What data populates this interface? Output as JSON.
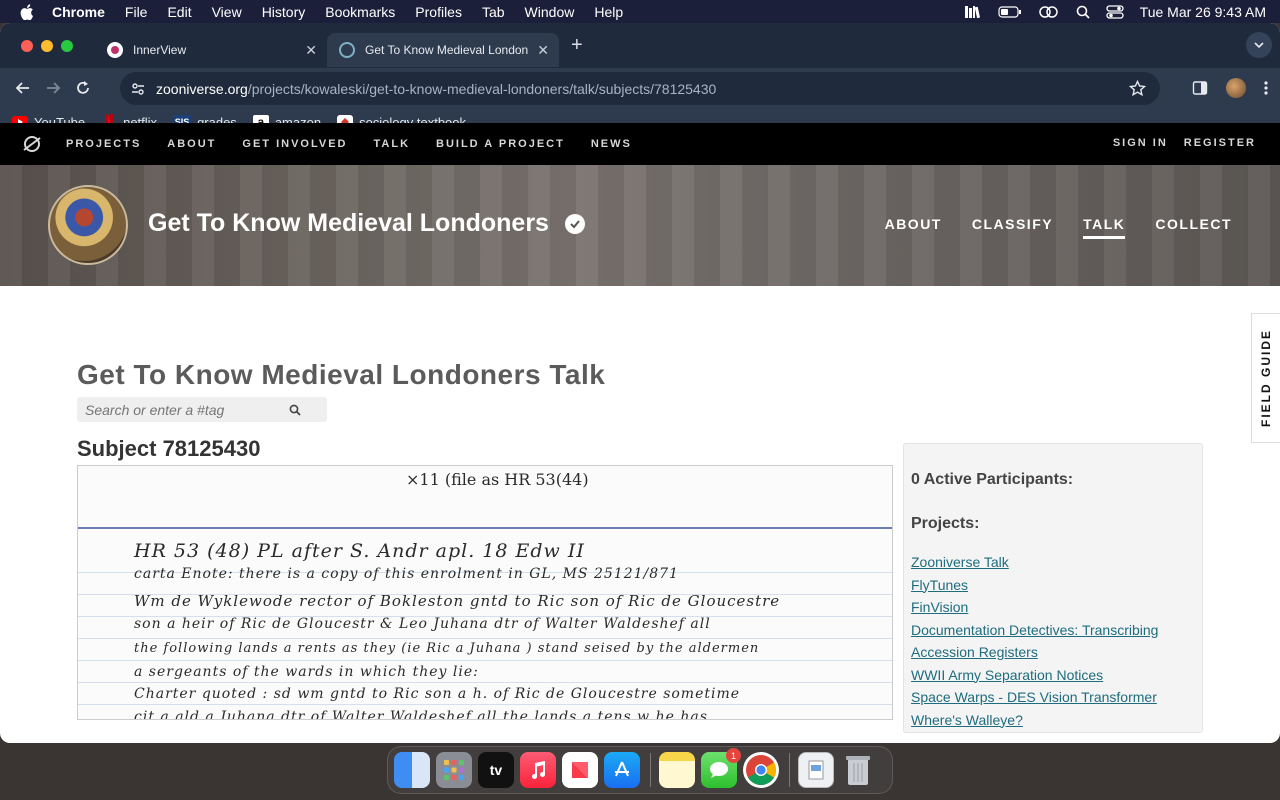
{
  "menubar": {
    "items": [
      "Chrome",
      "File",
      "Edit",
      "View",
      "History",
      "Bookmarks",
      "Profiles",
      "Tab",
      "Window",
      "Help"
    ],
    "clock": "Tue Mar 26  9:43 AM"
  },
  "tabs": [
    {
      "title": "InnerView",
      "active": false
    },
    {
      "title": "Get To Know Medieval London",
      "active": true
    }
  ],
  "omnibox": {
    "host": "zooniverse.org",
    "path": "/projects/kowaleski/get-to-know-medieval-londoners/talk/subjects/78125430"
  },
  "bookmarks": [
    {
      "label": "YouTube",
      "icon": "youtube-icon",
      "color": "#ff0000"
    },
    {
      "label": "netflix",
      "icon": "netflix-icon",
      "color": "#e50914"
    },
    {
      "label": "grades",
      "icon": "sis-icon",
      "color": "#1d3f7a",
      "glyph": "SIS"
    },
    {
      "label": "amazon",
      "icon": "amazon-icon",
      "color": "#ffffff",
      "glyph": "a"
    },
    {
      "label": "sociology textbook",
      "icon": "textbook-icon",
      "color": "#d9352b"
    }
  ],
  "sitenav": {
    "links": [
      "PROJECTS",
      "ABOUT",
      "GET INVOLVED",
      "TALK",
      "BUILD A PROJECT",
      "NEWS"
    ],
    "sign_in": "SIGN IN",
    "register": "REGISTER"
  },
  "project": {
    "title": "Get To Know Medieval Londoners",
    "nav": [
      "ABOUT",
      "CLASSIFY",
      "TALK",
      "COLLECT"
    ],
    "active_nav": "TALK"
  },
  "talk": {
    "title": "Get To Know Medieval Londoners Talk",
    "search_placeholder": "Search or enter a #tag",
    "subject_title": "Subject 78125430"
  },
  "subject_image": {
    "header": "×11     (file as HR 53(44)",
    "lines": [
      "HR 53 (48)          PL after S. Andr apl.  18 Edw II",
      "carta                   Enote: there is a copy of this enrolment in GL, MS 25121/871",
      "Wm de   Wyklewode   rector of   Bokleston  gntd  to  Ric son of  Ric de Gloucestre",
      "son  a heir of  Ric  de  Gloucestr   &  Leo  Juhana   dtr  of   Walter  Waldeshef  all",
      "the  following   lands   a  rents   as  they  (ie Ric a Juhana )  stand  seised  by  the  aldermen",
      "a  sergeants of   the   wards     in  which   they   lie:",
      "Charter  quoted :    sd  wm    gntd   to    Ric  son  a h. of Ric de  Gloucestre  sometime",
      "cit  a ald    a  Juhana   dtr  of   Walter  Waldeshef   all  the  lands  a  tens  w  he  has"
    ]
  },
  "sidebar": {
    "participants": "0 Active Participants:",
    "projects_heading": "Projects:",
    "projects": [
      "Zooniverse Talk",
      "FlyTunes",
      "FinVision",
      "Documentation Detectives: Transcribing Accession Registers",
      "WWII Army Separation Notices",
      "Space Warps - DES Vision Transformer",
      "Where's Walleye?"
    ]
  },
  "field_guide": "FIELD GUIDE",
  "dock": {
    "apps": [
      "Finder",
      "Launchpad",
      "Apple TV",
      "Music",
      "News",
      "App Store",
      "Notes",
      "Messages",
      "Chrome",
      "Preview",
      "Trash"
    ],
    "messages_badge": "1",
    "appletv_label": "tv"
  }
}
